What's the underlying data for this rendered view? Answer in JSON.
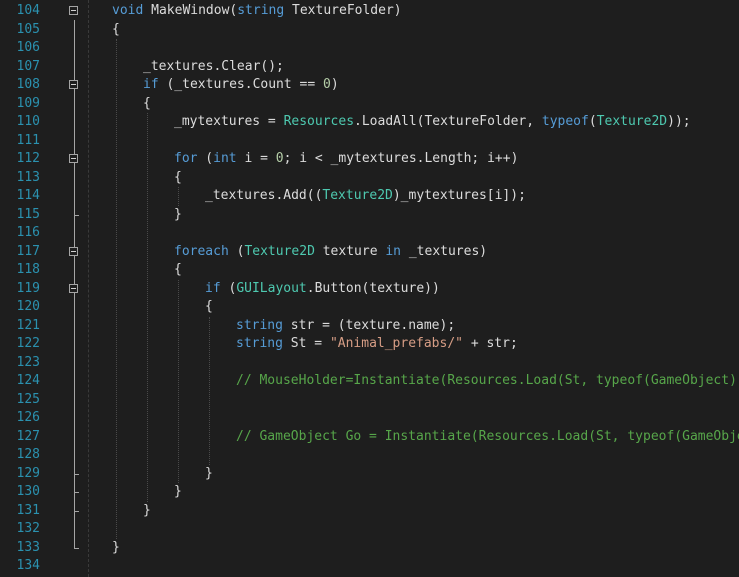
{
  "editor": {
    "colors": {
      "background": "#1e1e1e",
      "line_number": "#2b91af",
      "keyword": "#569cd6",
      "type": "#4ec9b0",
      "string": "#d69d85",
      "comment": "#57a64a",
      "number": "#b5cea8",
      "plain": "#dcdcdc"
    },
    "lines": [
      {
        "num": "104",
        "fold": true,
        "indent": 0,
        "tokens": [
          {
            "t": "void",
            "c": "kw"
          },
          {
            "t": " MakeWindow(",
            "c": "pl"
          },
          {
            "t": "string",
            "c": "kw"
          },
          {
            "t": " TextureFolder)",
            "c": "pl"
          }
        ]
      },
      {
        "num": "105",
        "fold": false,
        "indent": 0,
        "tokens": [
          {
            "t": "{",
            "c": "pl"
          }
        ]
      },
      {
        "num": "106",
        "fold": false,
        "indent": 0,
        "tokens": []
      },
      {
        "num": "107",
        "fold": false,
        "indent": 1,
        "tokens": [
          {
            "t": "_textures.Clear();",
            "c": "pl"
          }
        ]
      },
      {
        "num": "108",
        "fold": true,
        "indent": 1,
        "tokens": [
          {
            "t": "if",
            "c": "kw"
          },
          {
            "t": " (_textures.Count == ",
            "c": "pl"
          },
          {
            "t": "0",
            "c": "nu"
          },
          {
            "t": ")",
            "c": "pl"
          }
        ]
      },
      {
        "num": "109",
        "fold": false,
        "indent": 1,
        "tokens": [
          {
            "t": "{",
            "c": "pl"
          }
        ]
      },
      {
        "num": "110",
        "fold": false,
        "indent": 2,
        "tokens": [
          {
            "t": "_mytextures = ",
            "c": "pl"
          },
          {
            "t": "Resources",
            "c": "ty"
          },
          {
            "t": ".LoadAll(TextureFolder, ",
            "c": "pl"
          },
          {
            "t": "typeof",
            "c": "kw"
          },
          {
            "t": "(",
            "c": "pl"
          },
          {
            "t": "Texture2D",
            "c": "ty"
          },
          {
            "t": "));",
            "c": "pl"
          }
        ]
      },
      {
        "num": "111",
        "fold": false,
        "indent": 0,
        "tokens": []
      },
      {
        "num": "112",
        "fold": true,
        "indent": 2,
        "tokens": [
          {
            "t": "for",
            "c": "kw"
          },
          {
            "t": " (",
            "c": "pl"
          },
          {
            "t": "int",
            "c": "kw"
          },
          {
            "t": " i = ",
            "c": "pl"
          },
          {
            "t": "0",
            "c": "nu"
          },
          {
            "t": "; i < _mytextures.Length; i++)",
            "c": "pl"
          }
        ]
      },
      {
        "num": "113",
        "fold": false,
        "indent": 2,
        "tokens": [
          {
            "t": "{",
            "c": "pl"
          }
        ]
      },
      {
        "num": "114",
        "fold": false,
        "indent": 3,
        "tokens": [
          {
            "t": "_textures.Add((",
            "c": "pl"
          },
          {
            "t": "Texture2D",
            "c": "ty"
          },
          {
            "t": ")_mytextures[i]);",
            "c": "pl"
          }
        ]
      },
      {
        "num": "115",
        "fold": false,
        "indent": 2,
        "tokens": [
          {
            "t": "}",
            "c": "pl"
          }
        ]
      },
      {
        "num": "116",
        "fold": false,
        "indent": 0,
        "tokens": []
      },
      {
        "num": "117",
        "fold": true,
        "indent": 2,
        "tokens": [
          {
            "t": "foreach",
            "c": "kw"
          },
          {
            "t": " (",
            "c": "pl"
          },
          {
            "t": "Texture2D",
            "c": "ty"
          },
          {
            "t": " texture ",
            "c": "pl"
          },
          {
            "t": "in",
            "c": "kw"
          },
          {
            "t": " _textures)",
            "c": "pl"
          }
        ]
      },
      {
        "num": "118",
        "fold": false,
        "indent": 2,
        "tokens": [
          {
            "t": "{",
            "c": "pl"
          }
        ]
      },
      {
        "num": "119",
        "fold": true,
        "indent": 3,
        "tokens": [
          {
            "t": "if",
            "c": "kw"
          },
          {
            "t": " (",
            "c": "pl"
          },
          {
            "t": "GUILayout",
            "c": "ty"
          },
          {
            "t": ".Button(texture))",
            "c": "pl"
          }
        ]
      },
      {
        "num": "120",
        "fold": false,
        "indent": 3,
        "tokens": [
          {
            "t": "{",
            "c": "pl"
          }
        ]
      },
      {
        "num": "121",
        "fold": false,
        "indent": 4,
        "tokens": [
          {
            "t": "string",
            "c": "kw"
          },
          {
            "t": " str = (texture.name);",
            "c": "pl"
          }
        ]
      },
      {
        "num": "122",
        "fold": false,
        "indent": 4,
        "tokens": [
          {
            "t": "string",
            "c": "kw"
          },
          {
            "t": " St = ",
            "c": "pl"
          },
          {
            "t": "\"Animal_prefabs/\"",
            "c": "st"
          },
          {
            "t": " + str;",
            "c": "pl"
          }
        ]
      },
      {
        "num": "123",
        "fold": false,
        "indent": 0,
        "tokens": []
      },
      {
        "num": "124",
        "fold": false,
        "indent": 4,
        "tokens": [
          {
            "t": "// MouseHolder=Instantiate(Resources.Load(St, typeof(GameObject)) as GameObject;",
            "c": "cm"
          }
        ]
      },
      {
        "num": "125",
        "fold": false,
        "indent": 0,
        "tokens": []
      },
      {
        "num": "126",
        "fold": false,
        "indent": 0,
        "tokens": []
      },
      {
        "num": "127",
        "fold": false,
        "indent": 4,
        "tokens": [
          {
            "t": "// GameObject Go = Instantiate(Resources.Load(St, typeof(GameObject)) as GameObject;",
            "c": "cm"
          }
        ]
      },
      {
        "num": "128",
        "fold": false,
        "indent": 0,
        "tokens": []
      },
      {
        "num": "129",
        "fold": false,
        "indent": 3,
        "tokens": [
          {
            "t": "}",
            "c": "pl"
          }
        ]
      },
      {
        "num": "130",
        "fold": false,
        "indent": 2,
        "tokens": [
          {
            "t": "}",
            "c": "pl"
          }
        ]
      },
      {
        "num": "131",
        "fold": false,
        "indent": 1,
        "tokens": [
          {
            "t": "}",
            "c": "pl"
          }
        ]
      },
      {
        "num": "132",
        "fold": false,
        "indent": 0,
        "tokens": []
      },
      {
        "num": "133",
        "fold": false,
        "indent": 0,
        "tokens": [
          {
            "t": "}",
            "c": "pl"
          }
        ]
      },
      {
        "num": "134",
        "fold": false,
        "indent": 0,
        "tokens": []
      }
    ]
  }
}
